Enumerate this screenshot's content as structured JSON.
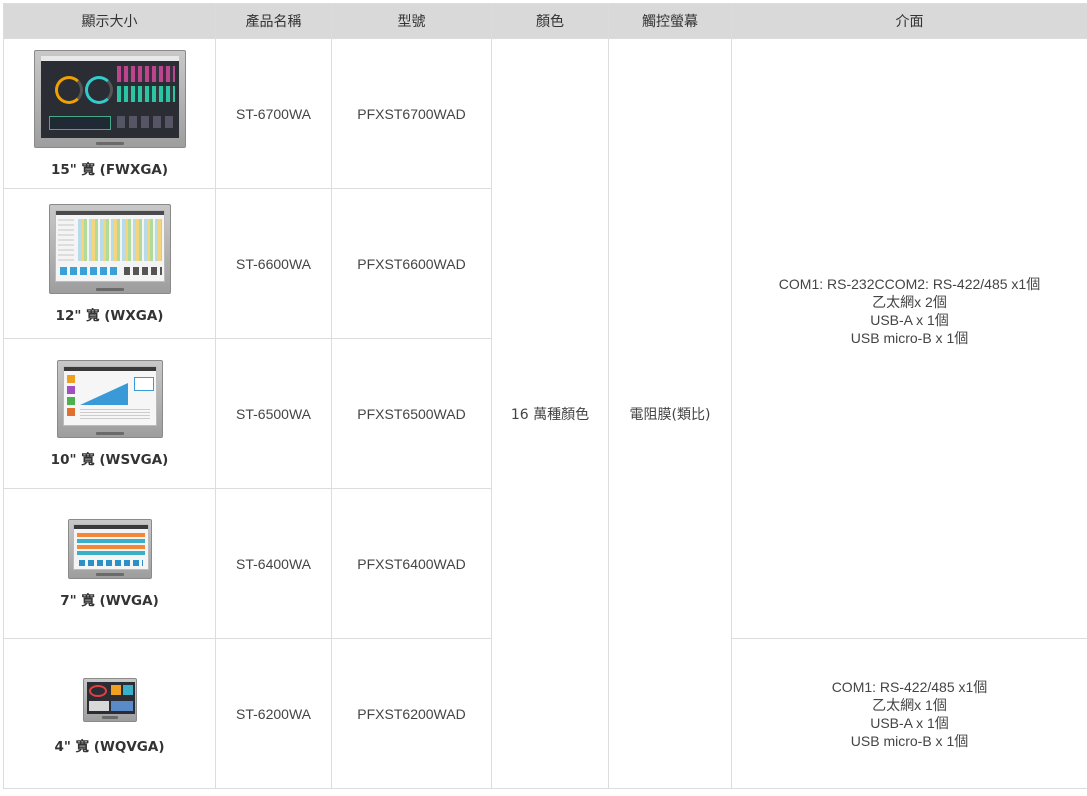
{
  "header": {
    "size": "顯示大小",
    "product_name": "產品名稱",
    "model": "型號",
    "color": "顏色",
    "touch": "觸控螢幕",
    "interface": "介面"
  },
  "rows": [
    {
      "size": "15\" 寬 (FWXGA)",
      "name": "ST-6700WA",
      "model": "PFXST6700WAD",
      "image_icon": "hmi-15-inch-device-icon"
    },
    {
      "size": "12\" 寬 (WXGA)",
      "name": "ST-6600WA",
      "model": "PFXST6600WAD",
      "image_icon": "hmi-12-inch-device-icon"
    },
    {
      "size": "10\" 寬 (WSVGA)",
      "name": "ST-6500WA",
      "model": "PFXST6500WAD",
      "image_icon": "hmi-10-inch-device-icon"
    },
    {
      "size": "7\" 寬 (WVGA)",
      "name": "ST-6400WA",
      "model": "PFXST6400WAD",
      "image_icon": "hmi-7-inch-device-icon"
    },
    {
      "size": "4\" 寬 (WQVGA)",
      "name": "ST-6200WA",
      "model": "PFXST6200WAD",
      "image_icon": "hmi-4-inch-device-icon"
    }
  ],
  "color_value": "16 萬種顏色",
  "touch_value": "電阻膜(類比)",
  "interface_a": [
    "COM1: RS-232CCOM2: RS-422/485 x1個",
    "乙太網x 2個",
    "USB-A x 1個",
    "USB micro-B x 1個"
  ],
  "interface_b": [
    "COM1: RS-422/485 x1個",
    "乙太網x 1個",
    "USB-A x 1個",
    "USB micro-B x 1個"
  ]
}
